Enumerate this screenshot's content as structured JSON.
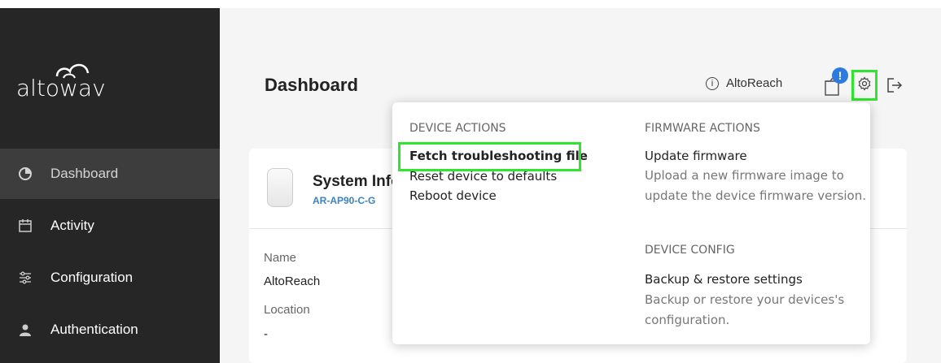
{
  "brand": {
    "logo_text": "altowav"
  },
  "sidebar": {
    "items": [
      {
        "label": "Dashboard",
        "icon": "pie-chart-icon",
        "active": true
      },
      {
        "label": "Activity",
        "icon": "calendar-icon",
        "active": false
      },
      {
        "label": "Configuration",
        "icon": "sliders-icon",
        "active": false
      },
      {
        "label": "Authentication",
        "icon": "user-icon",
        "active": false
      }
    ]
  },
  "header": {
    "title": "Dashboard",
    "device_name": "AltoReach",
    "notification_badge": "!",
    "icons": [
      "info-icon",
      "document-icon",
      "gear-icon",
      "logout-icon"
    ]
  },
  "card": {
    "title": "System Info",
    "model": "AR-AP90-C-G",
    "fields": [
      {
        "label": "Name",
        "value": "AltoReach"
      },
      {
        "label": "Location",
        "value": "-"
      }
    ]
  },
  "menu": {
    "device_actions": {
      "heading": "DEVICE ACTIONS",
      "items": [
        "Fetch troubleshooting file",
        "Reset device to defaults",
        "Reboot device"
      ]
    },
    "firmware_actions": {
      "heading": "FIRMWARE ACTIONS",
      "item": "Update firmware",
      "description": "Upload a new firmware image to update the device firmware version."
    },
    "device_config": {
      "heading": "DEVICE CONFIG",
      "item": "Backup & restore settings",
      "description": "Backup or restore your devices's configuration."
    }
  },
  "colors": {
    "sidebar_bg": "#262626",
    "sidebar_active": "#3d3d3d",
    "highlight": "#2ee62e",
    "badge": "#2d7be0",
    "model_link": "#3a82c8"
  }
}
